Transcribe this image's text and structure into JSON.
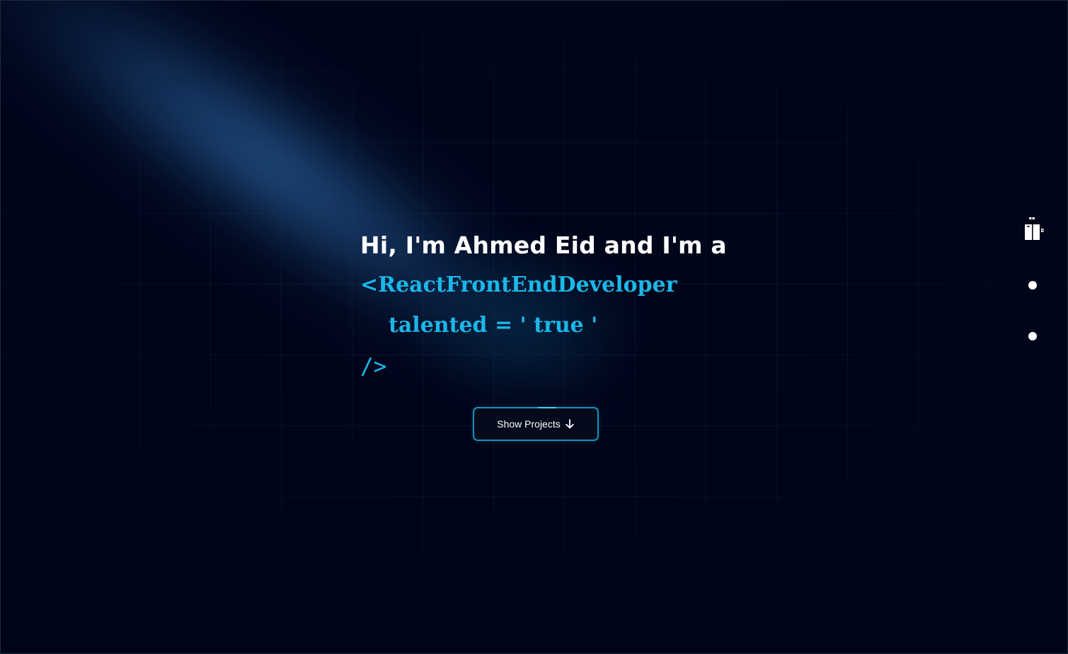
{
  "hero": {
    "greeting": "Hi, I'm Ahmed Eid and I'm a",
    "component_open": "<ReactFrontEndDeveloper",
    "component_prop": "talented = ' true '",
    "component_close": "/>"
  },
  "cta": {
    "label": "Show Projects",
    "icon": "arrow-down-icon"
  },
  "side_nav": {
    "icon": "elevator-icon",
    "dots": 2
  },
  "colors": {
    "background": "#00051a",
    "accent": "#1cb7e8",
    "button_border": "#1592b8",
    "text": "#ffffff"
  }
}
